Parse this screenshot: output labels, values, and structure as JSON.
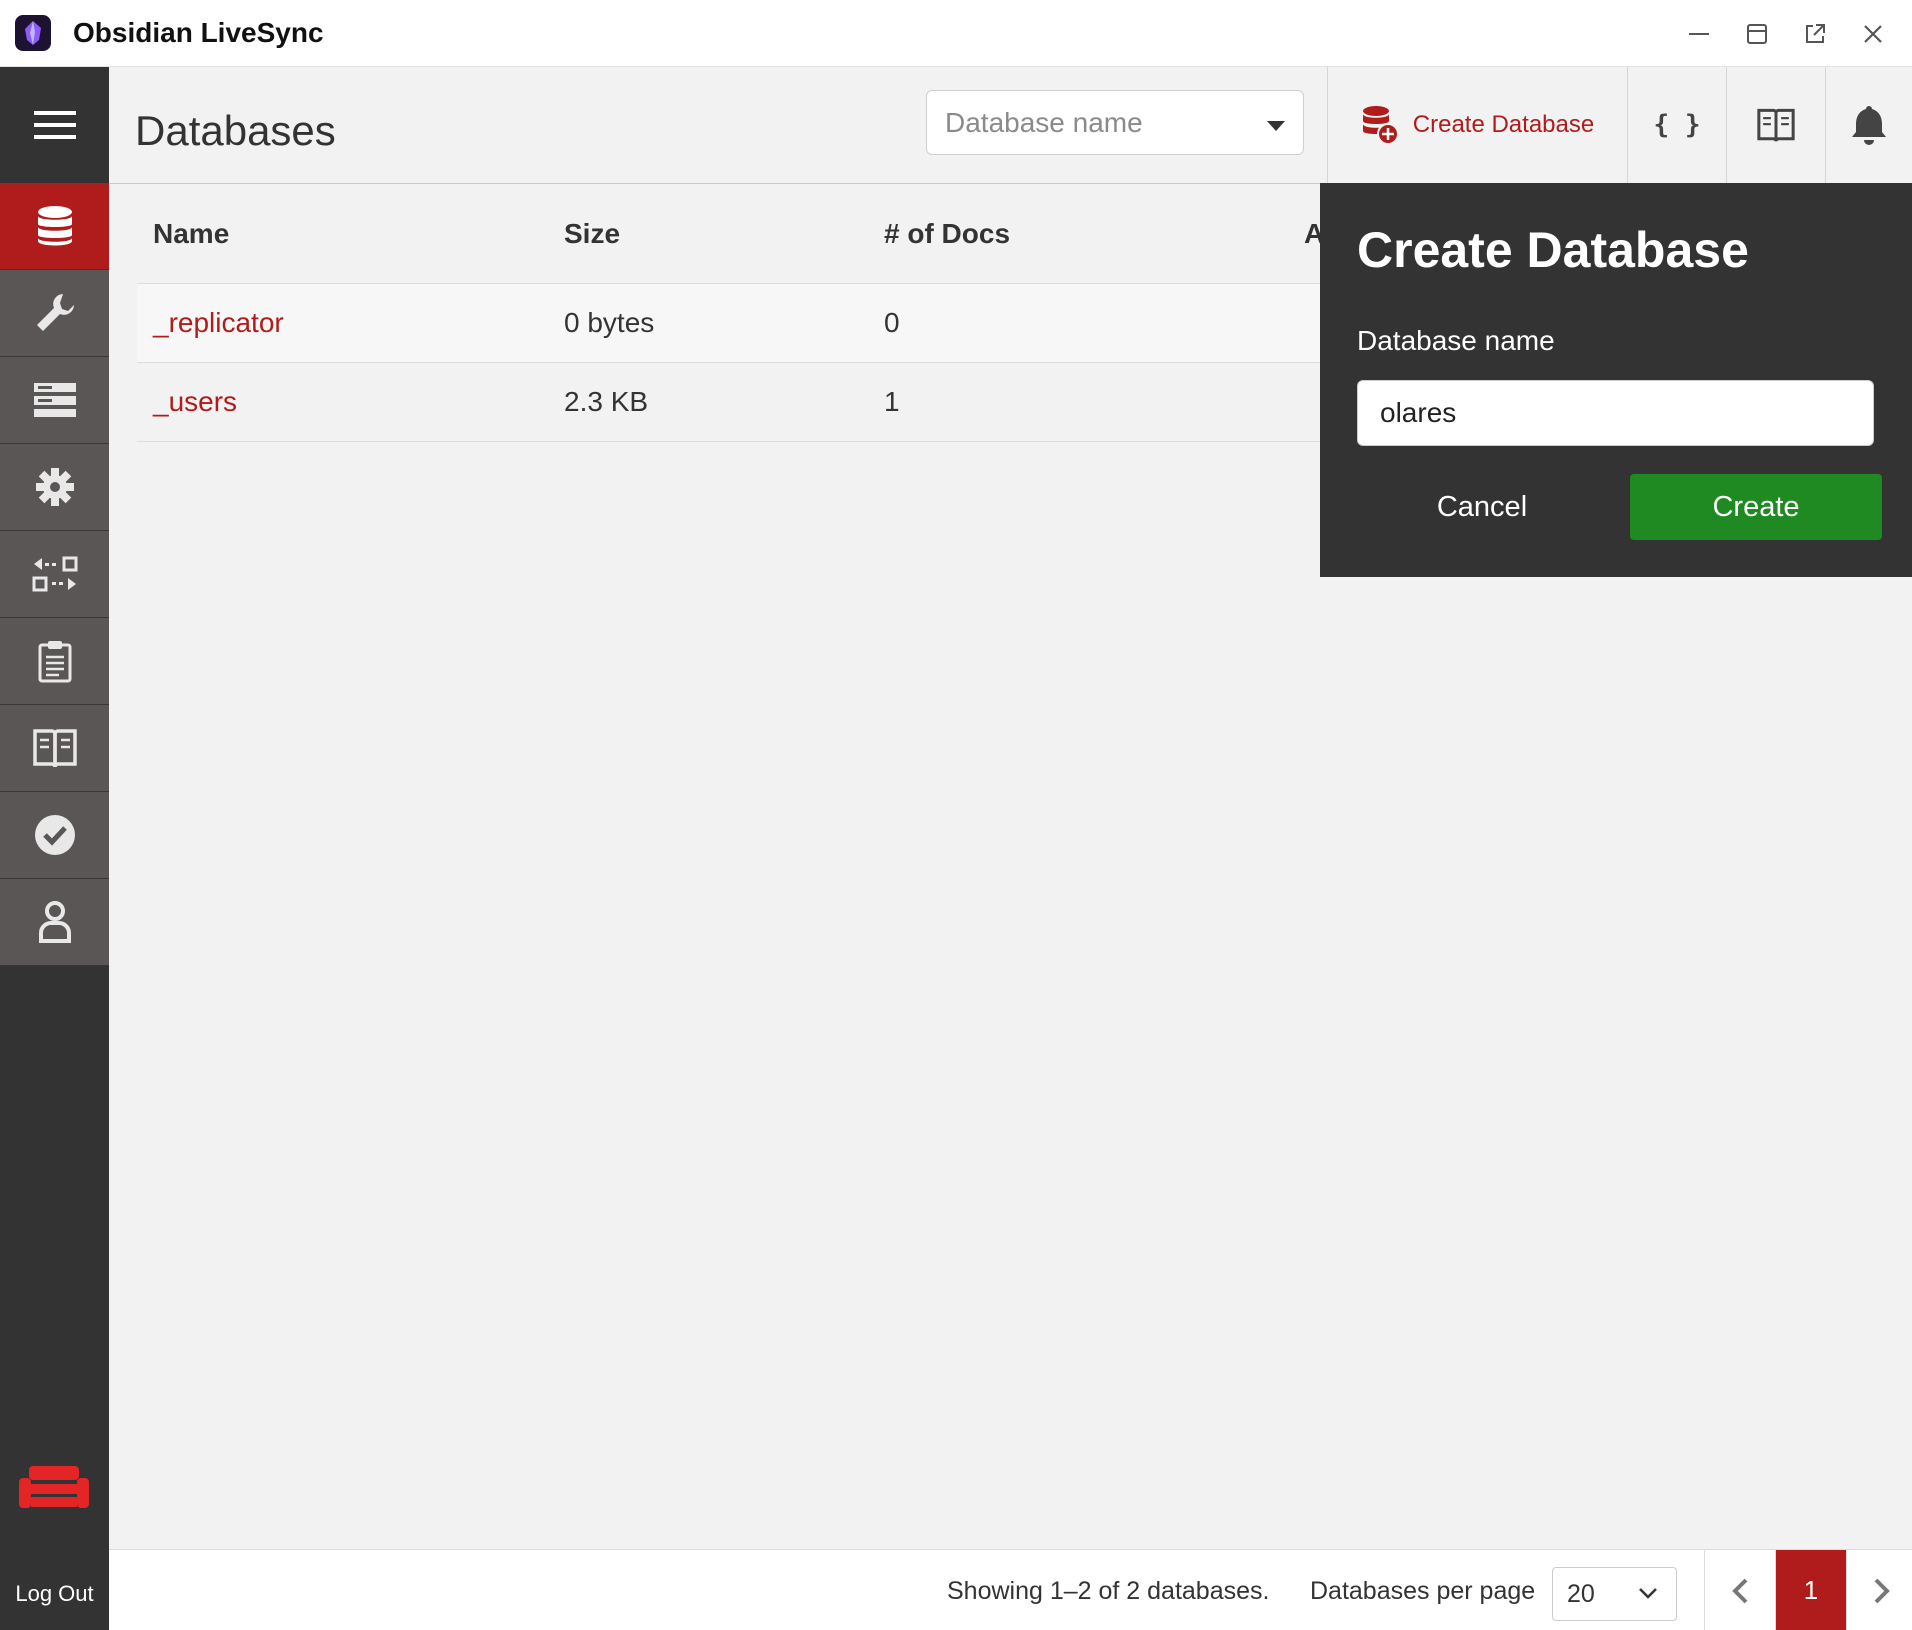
{
  "window": {
    "title": "Obsidian LiveSync"
  },
  "sidebar": {
    "items": [
      {
        "name": "databases",
        "icon": "database-icon",
        "active": true
      },
      {
        "name": "setup",
        "icon": "wrench-icon",
        "active": false
      },
      {
        "name": "active-tasks",
        "icon": "server-icon",
        "active": false
      },
      {
        "name": "config",
        "icon": "gear-icon",
        "active": false
      },
      {
        "name": "replication",
        "icon": "replicate-icon",
        "active": false
      },
      {
        "name": "active-tasks-list",
        "icon": "clipboard-icon",
        "active": false
      },
      {
        "name": "documentation",
        "icon": "book-icon",
        "active": false
      },
      {
        "name": "verify",
        "icon": "check-circle-icon",
        "active": false
      },
      {
        "name": "user",
        "icon": "user-icon",
        "active": false
      }
    ],
    "logout_label": "Log Out"
  },
  "header": {
    "title": "Databases",
    "db_select_placeholder": "Database name",
    "create_db_label": "Create Database",
    "json_label": "{ }"
  },
  "table": {
    "columns": [
      "Name",
      "Size",
      "# of Docs",
      "A"
    ],
    "rows": [
      {
        "name": "_replicator",
        "size": "0 bytes",
        "docs": "0"
      },
      {
        "name": "_users",
        "size": "2.3 KB",
        "docs": "1"
      }
    ]
  },
  "popover": {
    "title": "Create Database",
    "label": "Database name",
    "input_value": "olares",
    "cancel_label": "Cancel",
    "create_label": "Create"
  },
  "footer": {
    "showing": "Showing 1–2 of 2 databases.",
    "per_page_label": "Databases per page",
    "per_page_value": "20",
    "current_page": "1"
  },
  "colors": {
    "accent": "#b01c1c",
    "sidebar": "#333333",
    "create_green": "#1f8a22"
  }
}
